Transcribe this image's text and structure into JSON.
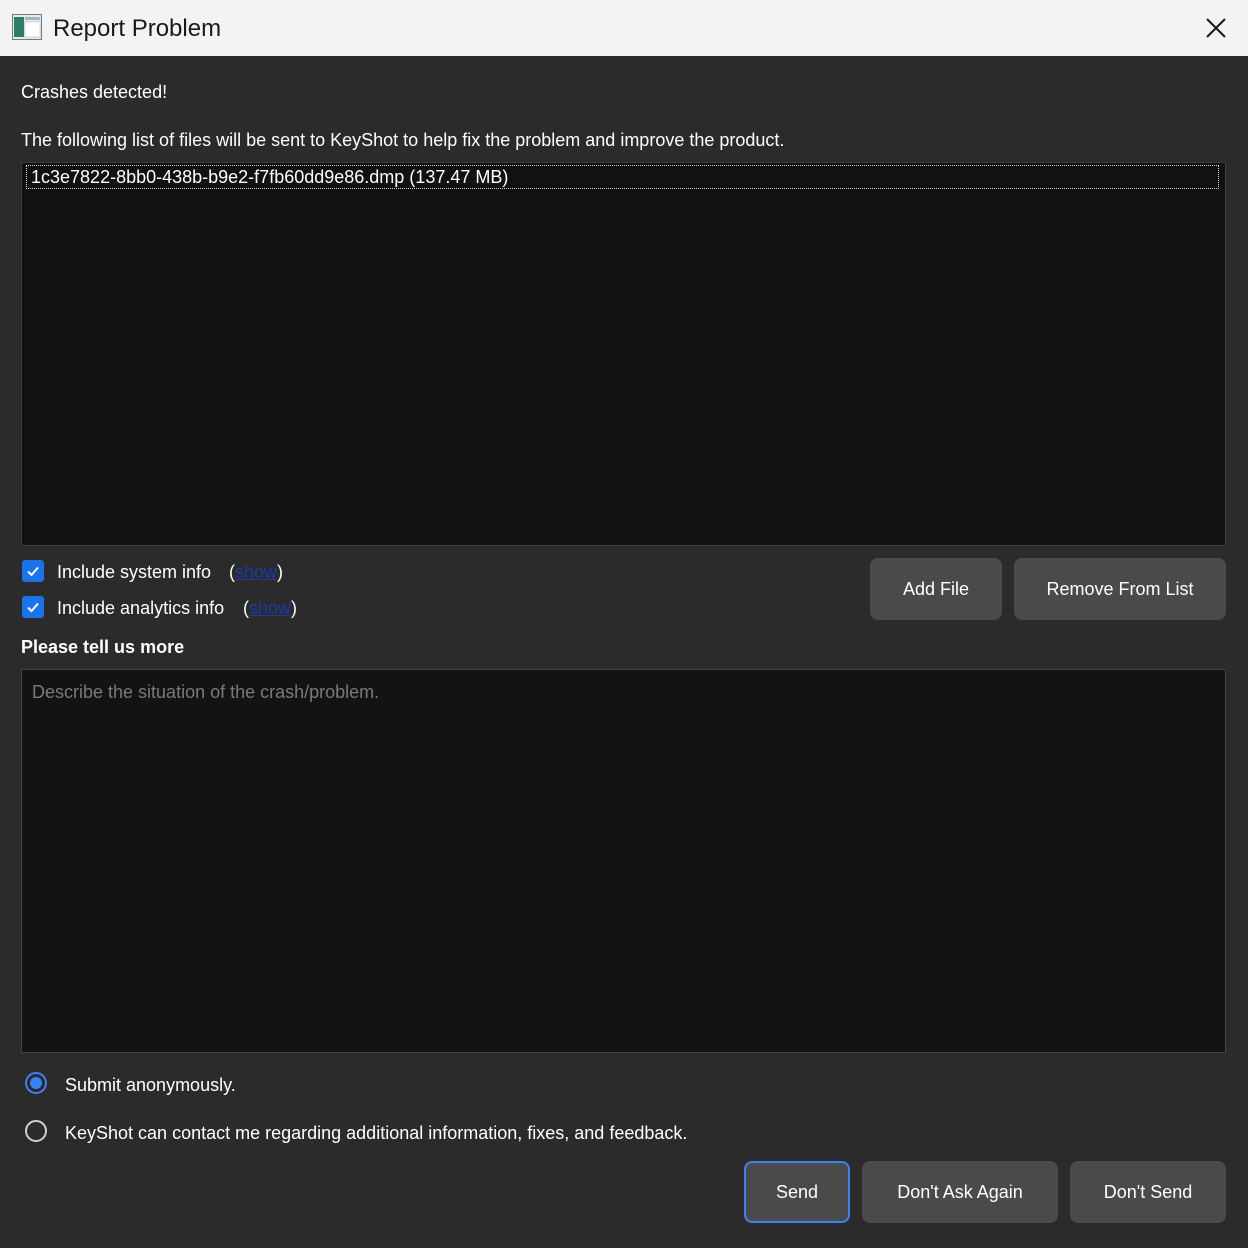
{
  "window": {
    "title": "Report Problem",
    "app_icon": "keyshot-app-icon",
    "close_icon": "close-icon"
  },
  "header": {
    "status": "Crashes detected!",
    "description": "The following list of files will be sent to KeyShot to help fix the problem and improve the product."
  },
  "files": [
    {
      "label": "1c3e7822-8bb0-438b-b9e2-f7fb60dd9e86.dmp (137.47 MB)"
    }
  ],
  "options": {
    "system_info": {
      "label": "Include system info",
      "checked": true,
      "open_paren": "(",
      "link": "show",
      "close_paren": ")"
    },
    "analytics_info": {
      "label": "Include analytics info",
      "checked": true,
      "open_paren": "(",
      "link": "show",
      "close_paren": ")"
    }
  },
  "file_buttons": {
    "add": "Add File",
    "remove": "Remove From List"
  },
  "details": {
    "heading": "Please tell us more",
    "placeholder": "Describe the situation of the crash/problem."
  },
  "contact": {
    "anonymous": {
      "label": "Submit anonymously.",
      "selected": true
    },
    "contact_me": {
      "label": "KeyShot can contact me regarding additional information, fixes, and feedback.",
      "selected": false
    }
  },
  "actions": {
    "send": "Send",
    "dont_ask": "Don't Ask Again",
    "dont_send": "Don't Send"
  },
  "colors": {
    "accent": "#3b82f6",
    "background": "#2b2b2b",
    "field": "#111111",
    "button": "#4a4a4a"
  }
}
